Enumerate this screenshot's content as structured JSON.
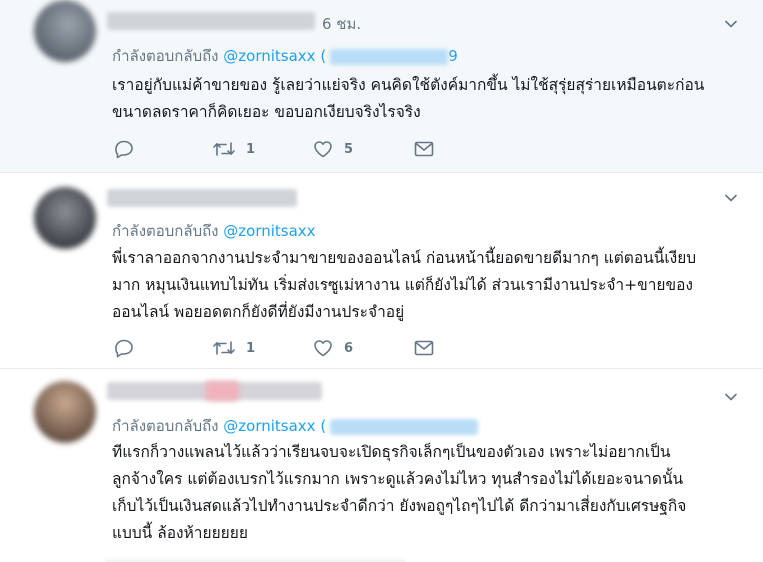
{
  "tweets": [
    {
      "time": "6 ชม.",
      "reply_prefix": "กำลังตอบกลับถึง",
      "reply_handle": "@zornitsaxx",
      "reply_extra_open": "(",
      "reply_extra_close": "9",
      "lines": [
        "เราอยู่กับแม่ค้าขายของ รู้เลยว่าแย่จริง คนคิดใช้ตังค์มากขึ้น ไม่ใช้สุรุ่ยสุร่ายเหมือนตะก่อน",
        "ขนาดลดราคาก็คิดเยอะ ขอบอกเงียบจริงไรจริง"
      ],
      "retweets": "1",
      "likes": "5"
    },
    {
      "reply_prefix": "กำลังตอบกลับถึง",
      "reply_handle": "@zornitsaxx",
      "lines": [
        "พี่เราลาออกจากงานประจำมาขายของออนไลน์ ก่อนหน้านี้ยอดขายดีมากๆ แต่ตอนนี้เงียบ",
        "มาก หมุนเงินแทบไม่ทัน เริ่มส่งเรซูเม่หางาน แต่ก็ยังไม่ได้ ส่วนเรามีงานประจำ+ขายของ",
        "ออนไลน์ พอยอดตกก็ยังดีที่ยังมีงานประจำอยู่"
      ],
      "retweets": "1",
      "likes": "6"
    },
    {
      "reply_prefix": "กำลังตอบกลับถึง",
      "reply_handle": "@zornitsaxx",
      "reply_extra_open": "(",
      "lines": [
        "ทีแรกก็วางแพลนไว้แล้วว่าเรียนจบจะเปิดธุรกิจเล็กๆเป็นของตัวเอง เพราะไม่อยากเป็น",
        "ลูกจ้างใคร แต่ต้องเบรกไว้แรกมาก เพราะดูแล้วคงไม่ไหว ทุนสำรองไม่ได้เยอะจนาดนั้น",
        "เก็บไว้เป็นเงินสดแล้วไปทำงานประจำดีกว่า ยังพอถูๆไถๆไปได้ ดีกว่ามาเสี่ยงกับเศรษฐกิจ",
        "แบบนี้ ล้องห้ายยยยย"
      ]
    }
  ],
  "colors": {
    "accent": "#1da1f2",
    "muted": "#657786",
    "text": "#14171a",
    "highlight_bg": "#f5f8fa"
  },
  "icons": [
    "chevron-down-icon",
    "reply-icon",
    "retweet-icon",
    "heart-icon",
    "direct-message-icon"
  ]
}
